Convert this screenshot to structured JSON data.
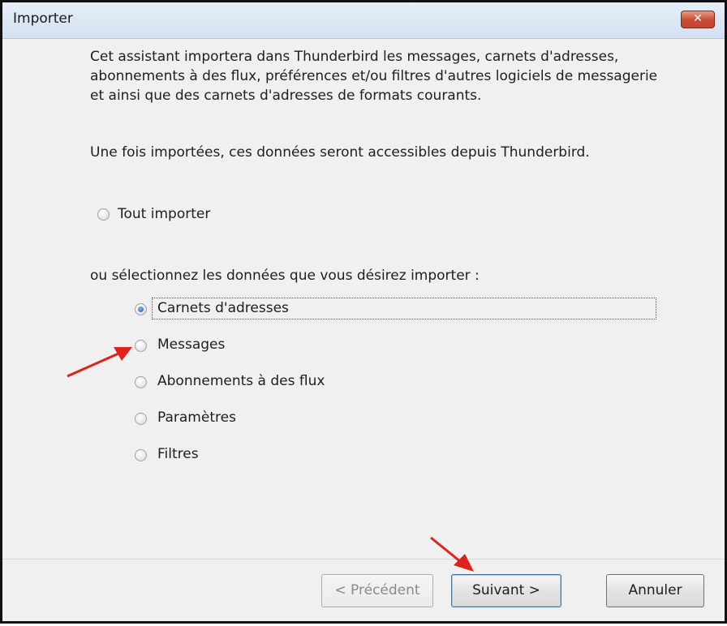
{
  "window": {
    "title": "Importer",
    "close_icon": "close-icon"
  },
  "intro": {
    "paragraph1": "Cet assistant importera dans Thunderbird les messages, carnets d'adresses, abonnements à des flux, préférences et/ou filtres d'autres logiciels de messagerie et ainsi que des carnets d'adresses de formats courants.",
    "paragraph2": "Une fois importées, ces données seront accessibles depuis Thunderbird."
  },
  "import_all": {
    "label": "Tout importer",
    "checked": false
  },
  "select_label": "ou sélectionnez les données que vous désirez importer :",
  "options": [
    {
      "label": "Carnets d'adresses",
      "checked": true
    },
    {
      "label": "Messages",
      "checked": false
    },
    {
      "label": "Abonnements à des flux",
      "checked": false
    },
    {
      "label": "Paramètres",
      "checked": false
    },
    {
      "label": "Filtres",
      "checked": false
    }
  ],
  "buttons": {
    "previous": "< Précédent",
    "next": "Suivant >",
    "cancel": "Annuler"
  },
  "colors": {
    "annotation_arrow": "#e0221c",
    "close_button": "#c84a32"
  }
}
